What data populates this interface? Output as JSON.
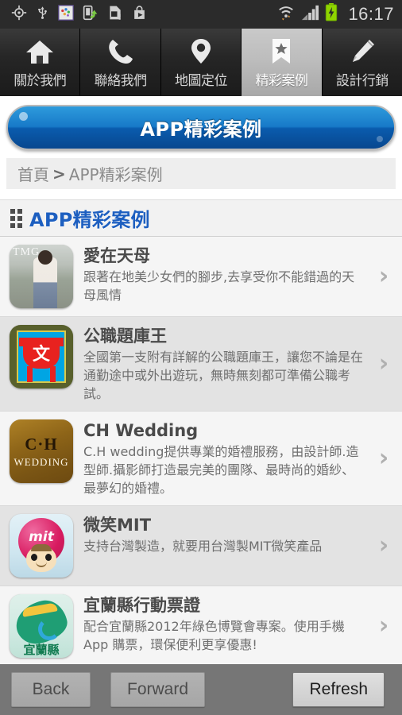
{
  "status_bar": {
    "time": "16:17",
    "left_icons": [
      "gps-icon",
      "usb-icon",
      "screenshot-icon",
      "file-transfer-icon",
      "sd-card-icon",
      "play-store-icon"
    ],
    "right_icons": [
      "wifi-icon",
      "signal-icon",
      "battery-charging-icon"
    ]
  },
  "tabs": [
    {
      "label": "關於我們",
      "icon": "home-icon",
      "active": false
    },
    {
      "label": "聯絡我們",
      "icon": "phone-icon",
      "active": false
    },
    {
      "label": "地圖定位",
      "icon": "location-pin-icon",
      "active": false
    },
    {
      "label": "精彩案例",
      "icon": "bookmark-star-icon",
      "active": true
    },
    {
      "label": "設計行銷",
      "icon": "pencil-icon",
      "active": false
    }
  ],
  "hero": {
    "title": "APP精彩案例"
  },
  "breadcrumb": {
    "home": "首頁",
    "separator": ">",
    "current": "APP精彩案例"
  },
  "section": {
    "title": "APP精彩案例",
    "icon": "grid-dots-icon"
  },
  "list": {
    "chevron": "›",
    "items": [
      {
        "title": "愛在天母",
        "desc": "跟著在地美少女們的腳步,去享受你不能錯過的天母風情",
        "thumb": "tmg-photo-thumbnail",
        "thumb_text": "TMG"
      },
      {
        "title": "公職題庫王",
        "desc": "全國第一支附有詳解的公職題庫王，讓您不論是在通勤途中或外出遊玩，無時無刻都可準備公職考試。",
        "thumb": "ding-vessel-thumbnail",
        "thumb_text": "文"
      },
      {
        "title": "CH Wedding",
        "desc": "C.H wedding提供專業的婚禮服務，由設計師.造型師.攝影師打造最完美的團隊、最時尚的婚紗、最夢幻的婚禮。",
        "thumb": "ch-wedding-thumbnail",
        "thumb_text_1": "C·H",
        "thumb_text_2": "WEDDING"
      },
      {
        "title": "微笑MIT",
        "desc": "支持台灣製造，就要用台灣製MIT微笑產品",
        "thumb": "mit-smile-thumbnail",
        "thumb_text": "mit"
      },
      {
        "title": "宜蘭縣行動票證",
        "desc": "配合宜蘭縣2012年綠色博覽會專案。使用手機App 購票，環保便利更享優惠!",
        "thumb": "yilan-county-thumbnail",
        "thumb_text": "宜蘭縣"
      }
    ]
  },
  "bottom_bar": {
    "back": "Back",
    "forward": "Forward",
    "refresh": "Refresh"
  },
  "colors": {
    "accent_blue": "#1d5fc0",
    "hero_blue": "#1779c8",
    "status_bar_bg": "#2b2b2b",
    "bottom_bar_bg": "#767676",
    "battery_green": "#8fd400"
  }
}
